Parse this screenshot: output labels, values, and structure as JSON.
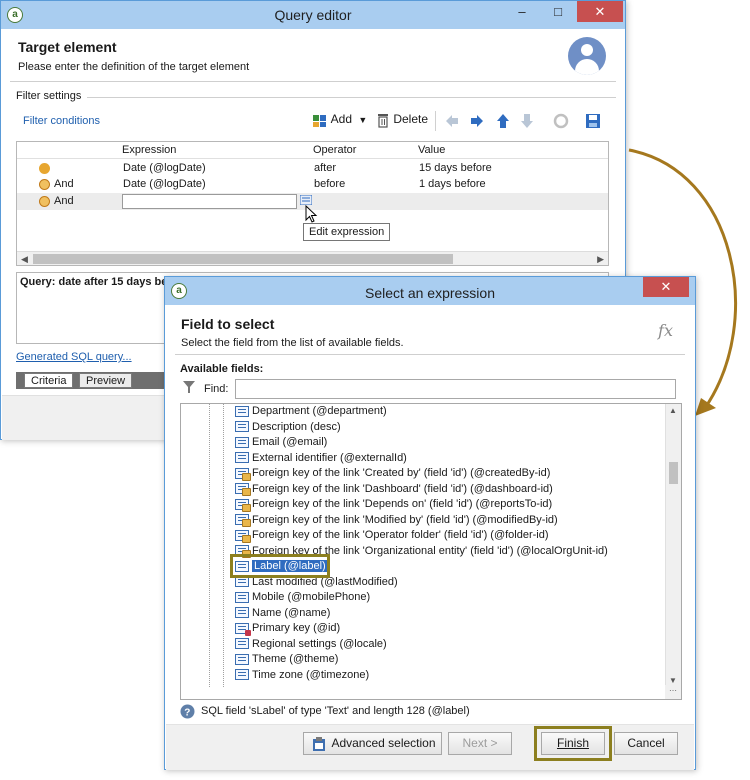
{
  "query_editor": {
    "window_title": "Query editor",
    "header_title": "Target element",
    "header_subtitle": "Please enter the definition of the target element",
    "filter_settings_label": "Filter settings",
    "filter_conditions_label": "Filter conditions",
    "toolbar": {
      "add_label": "Add",
      "delete_label": "Delete"
    },
    "columns": {
      "expression": "Expression",
      "operator": "Operator",
      "value": "Value"
    },
    "rows": [
      {
        "logic": "",
        "expression": "Date (@logDate)",
        "operator": "after",
        "value": "15 days before"
      },
      {
        "logic": "And",
        "expression": "Date (@logDate)",
        "operator": "before",
        "value": "1 days before"
      },
      {
        "logic": "And",
        "expression": "",
        "operator": "",
        "value": ""
      }
    ],
    "tooltip": "Edit expression",
    "query_summary": "Query: date after 15 days be",
    "sql_link": "Generated SQL query...",
    "tabs": [
      "Criteria",
      "Preview"
    ]
  },
  "select_expression": {
    "window_title": "Select an expression",
    "header_title": "Field to select",
    "header_subtitle": "Select the field from the list of available fields.",
    "fx_icon": "fx",
    "available_fields_label": "Available fields:",
    "find_label": "Find:",
    "find_value": "",
    "fields": [
      {
        "label": "Department (@department)",
        "icon": "field"
      },
      {
        "label": "Description (desc)",
        "icon": "field"
      },
      {
        "label": "Email (@email)",
        "icon": "field"
      },
      {
        "label": "External identifier (@externalId)",
        "icon": "field"
      },
      {
        "label": "Foreign key of the link 'Created by' (field 'id') (@createdBy-id)",
        "icon": "foreign-key"
      },
      {
        "label": "Foreign key of the link 'Dashboard' (field 'id') (@dashboard-id)",
        "icon": "foreign-key"
      },
      {
        "label": "Foreign key of the link 'Depends on' (field 'id') (@reportsTo-id)",
        "icon": "foreign-key"
      },
      {
        "label": "Foreign key of the link 'Modified by' (field 'id') (@modifiedBy-id)",
        "icon": "foreign-key"
      },
      {
        "label": "Foreign key of the link 'Operator folder' (field 'id') (@folder-id)",
        "icon": "foreign-key"
      },
      {
        "label": "Foreign key of the link 'Organizational entity' (field 'id') (@localOrgUnit-id)",
        "icon": "foreign-key"
      },
      {
        "label": "Label (@label)",
        "icon": "field",
        "selected": true
      },
      {
        "label": "Last modified (@lastModified)",
        "icon": "field"
      },
      {
        "label": "Mobile (@mobilePhone)",
        "icon": "field"
      },
      {
        "label": "Name (@name)",
        "icon": "field"
      },
      {
        "label": "Primary key (@id)",
        "icon": "primary-key"
      },
      {
        "label": "Regional settings (@locale)",
        "icon": "field"
      },
      {
        "label": "Theme (@theme)",
        "icon": "field"
      },
      {
        "label": "Time zone (@timezone)",
        "icon": "field"
      }
    ],
    "status_text": "SQL field 'sLabel' of type 'Text' and length 128 (@label)",
    "buttons": {
      "advanced": "Advanced selection",
      "next": "Next >",
      "finish": "Finish",
      "cancel": "Cancel"
    }
  },
  "colors": {
    "highlight_box": "#8c7f1f",
    "arrow": "#a5781e",
    "selection": "#2f6cc0",
    "link": "#1f5fae"
  }
}
